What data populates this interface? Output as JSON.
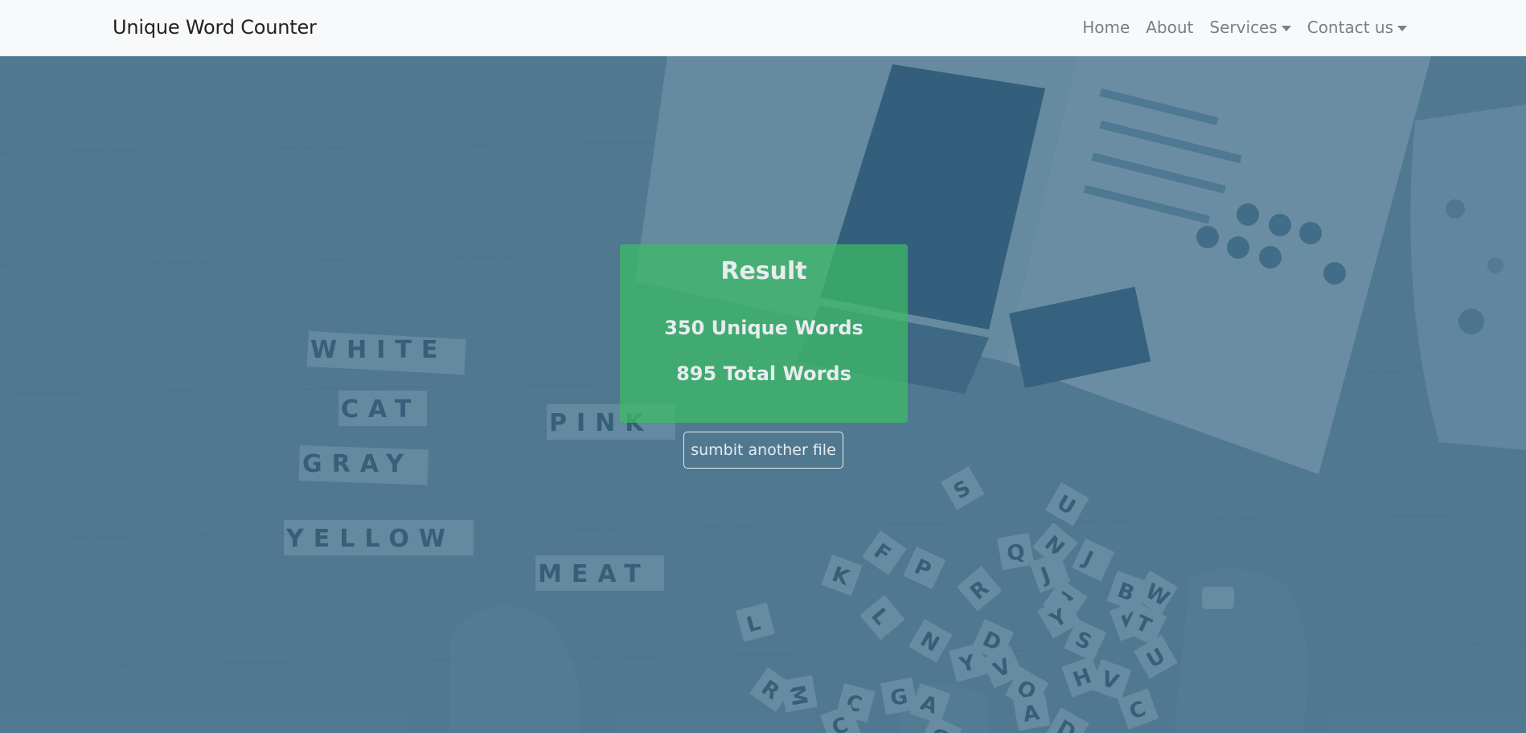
{
  "navbar": {
    "brand": "Unique Word Counter",
    "items": [
      {
        "label": "Home",
        "dropdown": false
      },
      {
        "label": "About",
        "dropdown": false
      },
      {
        "label": "Services",
        "dropdown": true
      },
      {
        "label": "Contact us",
        "dropdown": true
      }
    ]
  },
  "result": {
    "title": "Result",
    "unique_words": "350 Unique Words",
    "total_words": "895 Total Words"
  },
  "submit_button": "sumbit another file",
  "background": {
    "words": [
      "WHITE",
      "CAT",
      "GRAY",
      "YELLOW",
      "MEAT",
      "PINK"
    ]
  },
  "colors": {
    "navbar_bg": "#f8f9fa",
    "overlay": "#215475",
    "result_card": "#3cbe64"
  }
}
